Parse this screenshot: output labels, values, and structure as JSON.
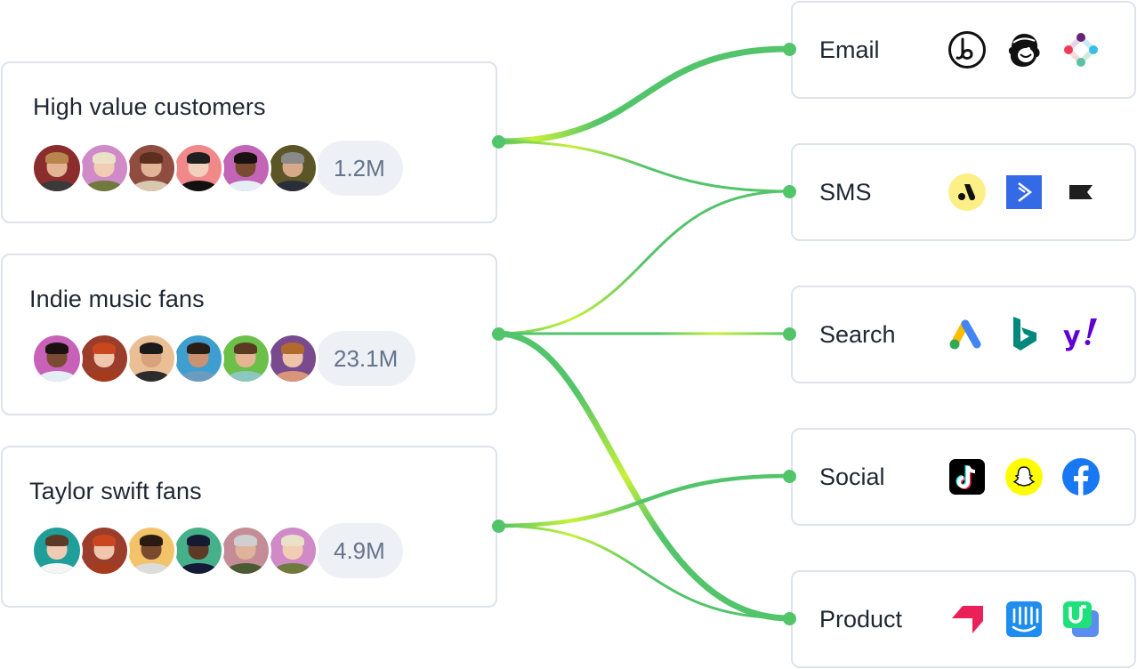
{
  "colors": {
    "flow_green": "#52c46a",
    "flow_lime": "#c8f03a",
    "card_border": "#dde3ec",
    "count_bg": "#edf0f5",
    "count_text": "#64748b",
    "title_text": "#1f2733"
  },
  "segments": [
    {
      "name": "High value customers",
      "count": "1.2M",
      "avatars": [
        {
          "bg": "#8b2d2d",
          "skin": "#e3b594",
          "hair": "#b8864d",
          "shirt": "#3a3a3a"
        },
        {
          "bg": "#cf8ac7",
          "skin": "#f1cdb3",
          "hair": "#e9e1c8",
          "shirt": "#6f7a3c"
        },
        {
          "bg": "#8f4c3f",
          "skin": "#e2b497",
          "hair": "#5b2e1d",
          "shirt": "#d9c8b0"
        },
        {
          "bg": "#f1888a",
          "skin": "#f2d0bd",
          "hair": "#1f1f1f",
          "shirt": "#111111"
        },
        {
          "bg": "#c365b7",
          "skin": "#7a4a32",
          "hair": "#1a1210",
          "shirt": "#e6eef5"
        },
        {
          "bg": "#5b5528",
          "skin": "#d6a98b",
          "hair": "#8a8a8a",
          "shirt": "#2a2e3a"
        }
      ]
    },
    {
      "name": "Indie music fans",
      "count": "23.1M",
      "avatars": [
        {
          "bg": "#c862b8",
          "skin": "#7a4a32",
          "hair": "#1a1210",
          "shirt": "#e6eef5"
        },
        {
          "bg": "#9a3d2a",
          "skin": "#f0c6ad",
          "hair": "#c9461f",
          "shirt": "#a63a1c"
        },
        {
          "bg": "#ebbf96",
          "skin": "#d9a27d",
          "hair": "#1a1a1a",
          "shirt": "#2c2c2c"
        },
        {
          "bg": "#3f9ed0",
          "skin": "#c99270",
          "hair": "#2a1d15",
          "shirt": "#6b9cbf"
        },
        {
          "bg": "#6cc04a",
          "skin": "#e4b493",
          "hair": "#5a3a22",
          "shirt": "#8cc7c0"
        },
        {
          "bg": "#7a4a8f",
          "skin": "#efc3a8",
          "hair": "#b06a2e",
          "shirt": "#d9957a"
        }
      ]
    },
    {
      "name": "Taylor swift fans",
      "count": "4.9M",
      "avatars": [
        {
          "bg": "#1f9e9a",
          "skin": "#f0cbb4",
          "hair": "#5c3a26",
          "shirt": "#f5f5f5"
        },
        {
          "bg": "#9a3d2a",
          "skin": "#f0c6ad",
          "hair": "#c9461f",
          "shirt": "#a63a1c"
        },
        {
          "bg": "#f3c36a",
          "skin": "#7a4a2e",
          "hair": "#2a1b12",
          "shirt": "#dcdcdc"
        },
        {
          "bg": "#46b08a",
          "skin": "#5c3a26",
          "hair": "#141a33",
          "shirt": "#151a36"
        },
        {
          "bg": "#c48c97",
          "skin": "#e0b29a",
          "hair": "#cfcfcf",
          "shirt": "#4c5a34"
        },
        {
          "bg": "#cf8ac7",
          "skin": "#f1cdb3",
          "hair": "#e9e1c8",
          "shirt": "#6f7a3c"
        }
      ]
    }
  ],
  "channels": [
    {
      "name": "Email",
      "icons": [
        "braze-icon",
        "mailchimp-icon",
        "iterable-icon"
      ]
    },
    {
      "name": "SMS",
      "icons": [
        "attentive-icon",
        "activecampaign-icon",
        "klaviyo-flag-icon"
      ]
    },
    {
      "name": "Search",
      "icons": [
        "google-ads-icon",
        "bing-icon",
        "yahoo-icon"
      ]
    },
    {
      "name": "Social",
      "icons": [
        "tiktok-icon",
        "snapchat-icon",
        "facebook-icon"
      ]
    },
    {
      "name": "Product",
      "icons": [
        "airship-icon",
        "intercom-icon",
        "userpilot-icon"
      ]
    }
  ],
  "flows": [
    {
      "from": "High value customers",
      "to": "Email",
      "weight": "heavy"
    },
    {
      "from": "High value customers",
      "to": "SMS",
      "weight": "light"
    },
    {
      "from": "Indie music fans",
      "to": "SMS",
      "weight": "light"
    },
    {
      "from": "Indie music fans",
      "to": "Search",
      "weight": "light"
    },
    {
      "from": "Indie music fans",
      "to": "Product",
      "weight": "heavy"
    },
    {
      "from": "Taylor swift fans",
      "to": "Social",
      "weight": "medium"
    },
    {
      "from": "Taylor swift fans",
      "to": "Product",
      "weight": "light"
    }
  ]
}
